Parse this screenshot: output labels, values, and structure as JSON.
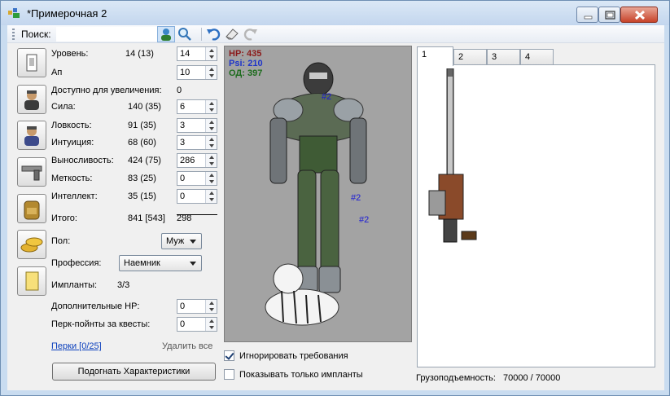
{
  "window": {
    "title": "*Примерочная 2"
  },
  "toolbar": {
    "search_label": "Поиск:",
    "search_value": ""
  },
  "stats": {
    "level": {
      "label": "Уровень:",
      "value": "14 (13)",
      "input": "14"
    },
    "ap": {
      "label": "Ап",
      "input": "10"
    },
    "available": {
      "label": "Доступно для увеличения:",
      "value": "0"
    },
    "strength": {
      "label": "Сила:",
      "value": "140 (35)",
      "input": "6"
    },
    "agility": {
      "label": "Ловкость:",
      "value": "91 (35)",
      "input": "3"
    },
    "intuition": {
      "label": "Интуиция:",
      "value": "68 (60)",
      "input": "3"
    },
    "endurance": {
      "label": "Выносливость:",
      "value": "424 (75)",
      "input": "286"
    },
    "accuracy": {
      "label": "Меткость:",
      "value": "83 (25)",
      "input": "0"
    },
    "intellect": {
      "label": "Интеллект:",
      "value": "35 (15)",
      "input": "0"
    },
    "total": {
      "label": "Итого:",
      "value": "841 [543]",
      "extra": "298"
    }
  },
  "gender": {
    "label": "Пол:",
    "value": "Муж"
  },
  "profession": {
    "label": "Профессия:",
    "value": "Наемник"
  },
  "implants": {
    "label": "Импланты:",
    "value": "3/3"
  },
  "extra_hp": {
    "label": "Дополнительные HP:",
    "input": "0"
  },
  "quest_perks": {
    "label": "Перк-пойнты за квесты:",
    "input": "0"
  },
  "perks_link": "Перки [0/25]",
  "delete_all": "Удалить все",
  "fit_button": "Подогнать Характеристики",
  "character": {
    "hp": "HP: 435",
    "psi": "Psi: 210",
    "od": "ОД: 397",
    "slot_marks": [
      "#2",
      "#2",
      "#2"
    ],
    "colors": {
      "hp": "#8b1a1a",
      "psi": "#1f35c9",
      "od": "#1d6b1d"
    }
  },
  "options": {
    "ignore_requirements": {
      "label": "Игнорировать требования",
      "checked": true
    },
    "only_implants": {
      "label": "Показывать только импланты",
      "checked": false
    }
  },
  "tabs": [
    "1",
    "2",
    "3",
    "4"
  ],
  "carry": {
    "label": "Грузоподъемность:",
    "value": "70000 / 70000"
  }
}
